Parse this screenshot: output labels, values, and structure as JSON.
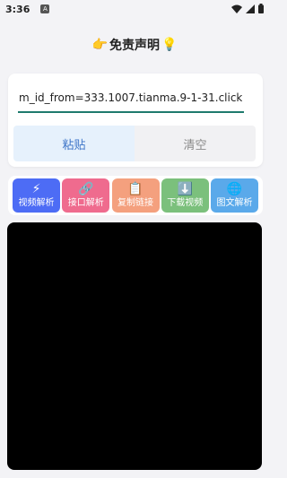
{
  "status_bar": {
    "time": "3:36",
    "app_icon_letter": "A"
  },
  "header": {
    "emoji_left": "👉",
    "title": "免责声明",
    "emoji_right": "💡"
  },
  "input": {
    "value": "m_id_from=333.1007.tianma.9-1-31.click"
  },
  "buttons": {
    "paste": "粘贴",
    "clear": "清空"
  },
  "tools": [
    {
      "icon": "⚡",
      "label": "视频解析",
      "color": "#4d6cf5"
    },
    {
      "icon": "🔗",
      "label": "接口解析",
      "color": "#ef6b8e"
    },
    {
      "icon": "📋",
      "label": "复制链接",
      "color": "#f4a07e"
    },
    {
      "icon": "⬇️",
      "label": "下载视频",
      "color": "#7bc07c"
    },
    {
      "icon": "🌐",
      "label": "图文解析",
      "color": "#5aa9ea"
    }
  ]
}
